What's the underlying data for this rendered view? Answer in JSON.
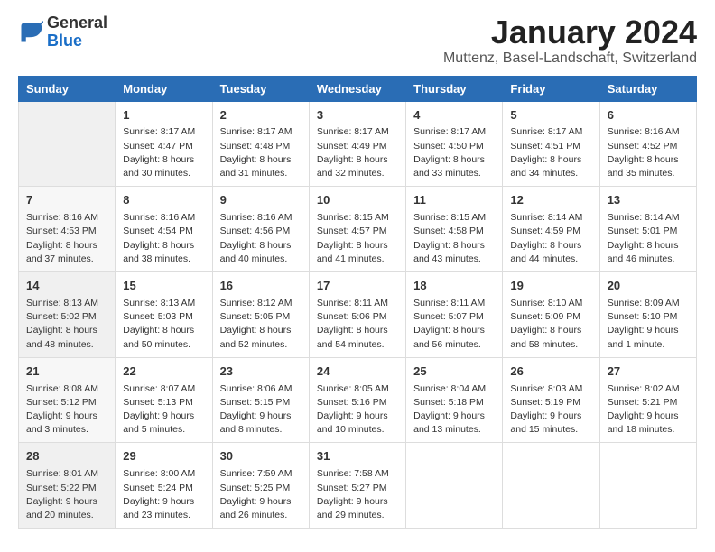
{
  "logo": {
    "general": "General",
    "blue": "Blue"
  },
  "calendar": {
    "title": "January 2024",
    "subtitle": "Muttenz, Basel-Landschaft, Switzerland"
  },
  "headers": [
    "Sunday",
    "Monday",
    "Tuesday",
    "Wednesday",
    "Thursday",
    "Friday",
    "Saturday"
  ],
  "weeks": [
    [
      {
        "day": "",
        "info": ""
      },
      {
        "day": "1",
        "info": "Sunrise: 8:17 AM\nSunset: 4:47 PM\nDaylight: 8 hours\nand 30 minutes."
      },
      {
        "day": "2",
        "info": "Sunrise: 8:17 AM\nSunset: 4:48 PM\nDaylight: 8 hours\nand 31 minutes."
      },
      {
        "day": "3",
        "info": "Sunrise: 8:17 AM\nSunset: 4:49 PM\nDaylight: 8 hours\nand 32 minutes."
      },
      {
        "day": "4",
        "info": "Sunrise: 8:17 AM\nSunset: 4:50 PM\nDaylight: 8 hours\nand 33 minutes."
      },
      {
        "day": "5",
        "info": "Sunrise: 8:17 AM\nSunset: 4:51 PM\nDaylight: 8 hours\nand 34 minutes."
      },
      {
        "day": "6",
        "info": "Sunrise: 8:16 AM\nSunset: 4:52 PM\nDaylight: 8 hours\nand 35 minutes."
      }
    ],
    [
      {
        "day": "7",
        "info": "Sunrise: 8:16 AM\nSunset: 4:53 PM\nDaylight: 8 hours\nand 37 minutes."
      },
      {
        "day": "8",
        "info": "Sunrise: 8:16 AM\nSunset: 4:54 PM\nDaylight: 8 hours\nand 38 minutes."
      },
      {
        "day": "9",
        "info": "Sunrise: 8:16 AM\nSunset: 4:56 PM\nDaylight: 8 hours\nand 40 minutes."
      },
      {
        "day": "10",
        "info": "Sunrise: 8:15 AM\nSunset: 4:57 PM\nDaylight: 8 hours\nand 41 minutes."
      },
      {
        "day": "11",
        "info": "Sunrise: 8:15 AM\nSunset: 4:58 PM\nDaylight: 8 hours\nand 43 minutes."
      },
      {
        "day": "12",
        "info": "Sunrise: 8:14 AM\nSunset: 4:59 PM\nDaylight: 8 hours\nand 44 minutes."
      },
      {
        "day": "13",
        "info": "Sunrise: 8:14 AM\nSunset: 5:01 PM\nDaylight: 8 hours\nand 46 minutes."
      }
    ],
    [
      {
        "day": "14",
        "info": "Sunrise: 8:13 AM\nSunset: 5:02 PM\nDaylight: 8 hours\nand 48 minutes."
      },
      {
        "day": "15",
        "info": "Sunrise: 8:13 AM\nSunset: 5:03 PM\nDaylight: 8 hours\nand 50 minutes."
      },
      {
        "day": "16",
        "info": "Sunrise: 8:12 AM\nSunset: 5:05 PM\nDaylight: 8 hours\nand 52 minutes."
      },
      {
        "day": "17",
        "info": "Sunrise: 8:11 AM\nSunset: 5:06 PM\nDaylight: 8 hours\nand 54 minutes."
      },
      {
        "day": "18",
        "info": "Sunrise: 8:11 AM\nSunset: 5:07 PM\nDaylight: 8 hours\nand 56 minutes."
      },
      {
        "day": "19",
        "info": "Sunrise: 8:10 AM\nSunset: 5:09 PM\nDaylight: 8 hours\nand 58 minutes."
      },
      {
        "day": "20",
        "info": "Sunrise: 8:09 AM\nSunset: 5:10 PM\nDaylight: 9 hours\nand 1 minute."
      }
    ],
    [
      {
        "day": "21",
        "info": "Sunrise: 8:08 AM\nSunset: 5:12 PM\nDaylight: 9 hours\nand 3 minutes."
      },
      {
        "day": "22",
        "info": "Sunrise: 8:07 AM\nSunset: 5:13 PM\nDaylight: 9 hours\nand 5 minutes."
      },
      {
        "day": "23",
        "info": "Sunrise: 8:06 AM\nSunset: 5:15 PM\nDaylight: 9 hours\nand 8 minutes."
      },
      {
        "day": "24",
        "info": "Sunrise: 8:05 AM\nSunset: 5:16 PM\nDaylight: 9 hours\nand 10 minutes."
      },
      {
        "day": "25",
        "info": "Sunrise: 8:04 AM\nSunset: 5:18 PM\nDaylight: 9 hours\nand 13 minutes."
      },
      {
        "day": "26",
        "info": "Sunrise: 8:03 AM\nSunset: 5:19 PM\nDaylight: 9 hours\nand 15 minutes."
      },
      {
        "day": "27",
        "info": "Sunrise: 8:02 AM\nSunset: 5:21 PM\nDaylight: 9 hours\nand 18 minutes."
      }
    ],
    [
      {
        "day": "28",
        "info": "Sunrise: 8:01 AM\nSunset: 5:22 PM\nDaylight: 9 hours\nand 20 minutes."
      },
      {
        "day": "29",
        "info": "Sunrise: 8:00 AM\nSunset: 5:24 PM\nDaylight: 9 hours\nand 23 minutes."
      },
      {
        "day": "30",
        "info": "Sunrise: 7:59 AM\nSunset: 5:25 PM\nDaylight: 9 hours\nand 26 minutes."
      },
      {
        "day": "31",
        "info": "Sunrise: 7:58 AM\nSunset: 5:27 PM\nDaylight: 9 hours\nand 29 minutes."
      },
      {
        "day": "",
        "info": ""
      },
      {
        "day": "",
        "info": ""
      },
      {
        "day": "",
        "info": ""
      }
    ]
  ]
}
